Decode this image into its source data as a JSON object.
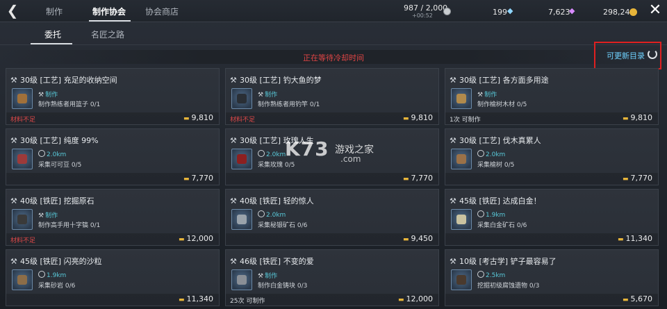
{
  "header": {
    "back_icon": "back-arrow-icon",
    "tabs": [
      "制作",
      "制作协会",
      "协会商店"
    ],
    "active_tab": 1,
    "stamina": "987 / 2,000",
    "stamina_timer": "+00:52",
    "gems_blue": "199",
    "gems_purple": "7,623",
    "gold": "298,246",
    "close_icon": "close-icon"
  },
  "subtabs": [
    "委托",
    "名匠之路"
  ],
  "cooldown_text": "正在等待冷却时间",
  "refresh_label": "可更新目录",
  "watermark": {
    "brand": "K73",
    "text1": "游戏之家",
    "text2": ".com"
  },
  "colors": {
    "accent_cyan": "#58c9d9",
    "warning_red": "#e04848",
    "gold": "#e7b53a",
    "highlight_box": "#e02020"
  },
  "cards": [
    {
      "title": "30级 [工艺] 充足的收纳空间",
      "line1": "制作",
      "line2": "制作熟练者用篮子 0/1",
      "status": "材料不足",
      "reward": "9,810",
      "icon": "tool"
    },
    {
      "title": "30级 [工艺] 钓大鱼的梦",
      "line1": "制作",
      "line2": "制作熟练者用钓竿 0/1",
      "status": "材料不足",
      "reward": "9,810",
      "icon": "tool"
    },
    {
      "title": "30级 [工艺] 各方面多用途",
      "line1": "制作",
      "line2": "制作榆树木材 0/5",
      "status": "1次 可制作",
      "reward": "9,810",
      "icon": "tool"
    },
    {
      "title": "30级 [工艺] 纯度 99%",
      "line1": "2.0km",
      "line2": "采集可可豆 0/5",
      "status": "",
      "reward": "7,770",
      "icon": "globe"
    },
    {
      "title": "30级 [工艺] 玫瑰人生",
      "line1": "2.0km",
      "line2": "采集玫瑰 0/5",
      "status": "",
      "reward": "7,770",
      "icon": "globe"
    },
    {
      "title": "30级 [工艺] 伐木真累人",
      "line1": "2.0km",
      "line2": "采集榆树 0/5",
      "status": "",
      "reward": "7,770",
      "icon": "globe"
    },
    {
      "title": "40级 [铁匠] 挖掘原石",
      "line1": "制作",
      "line2": "制作高手用十字镐 0/1",
      "status": "材料不足",
      "reward": "12,000",
      "icon": "tool"
    },
    {
      "title": "40级 [铁匠] 轻的惊人",
      "line1": "2.0km",
      "line2": "采集秘银矿石 0/6",
      "status": "",
      "reward": "9,450",
      "icon": "globe"
    },
    {
      "title": "45级 [铁匠] 达成白金！",
      "line1": "1.9km",
      "line2": "采集白金矿石 0/6",
      "status": "",
      "reward": "11,340",
      "icon": "globe"
    },
    {
      "title": "45级 [铁匠] 闪亮的沙粒",
      "line1": "1.9km",
      "line2": "采集砂岩 0/6",
      "status": "",
      "reward": "11,340",
      "icon": "globe"
    },
    {
      "title": "46级 [铁匠] 不变的爱",
      "line1": "制作",
      "line2": "制作白金铸块 0/3",
      "status": "25次 可制作",
      "reward": "12,000",
      "icon": "tool"
    },
    {
      "title": "10级 [考古学] 铲子最容易了",
      "line1": "2.5km",
      "line2": "挖掘初级腐蚀遗物 0/3",
      "status": "",
      "reward": "5,670",
      "icon": "globe"
    }
  ]
}
